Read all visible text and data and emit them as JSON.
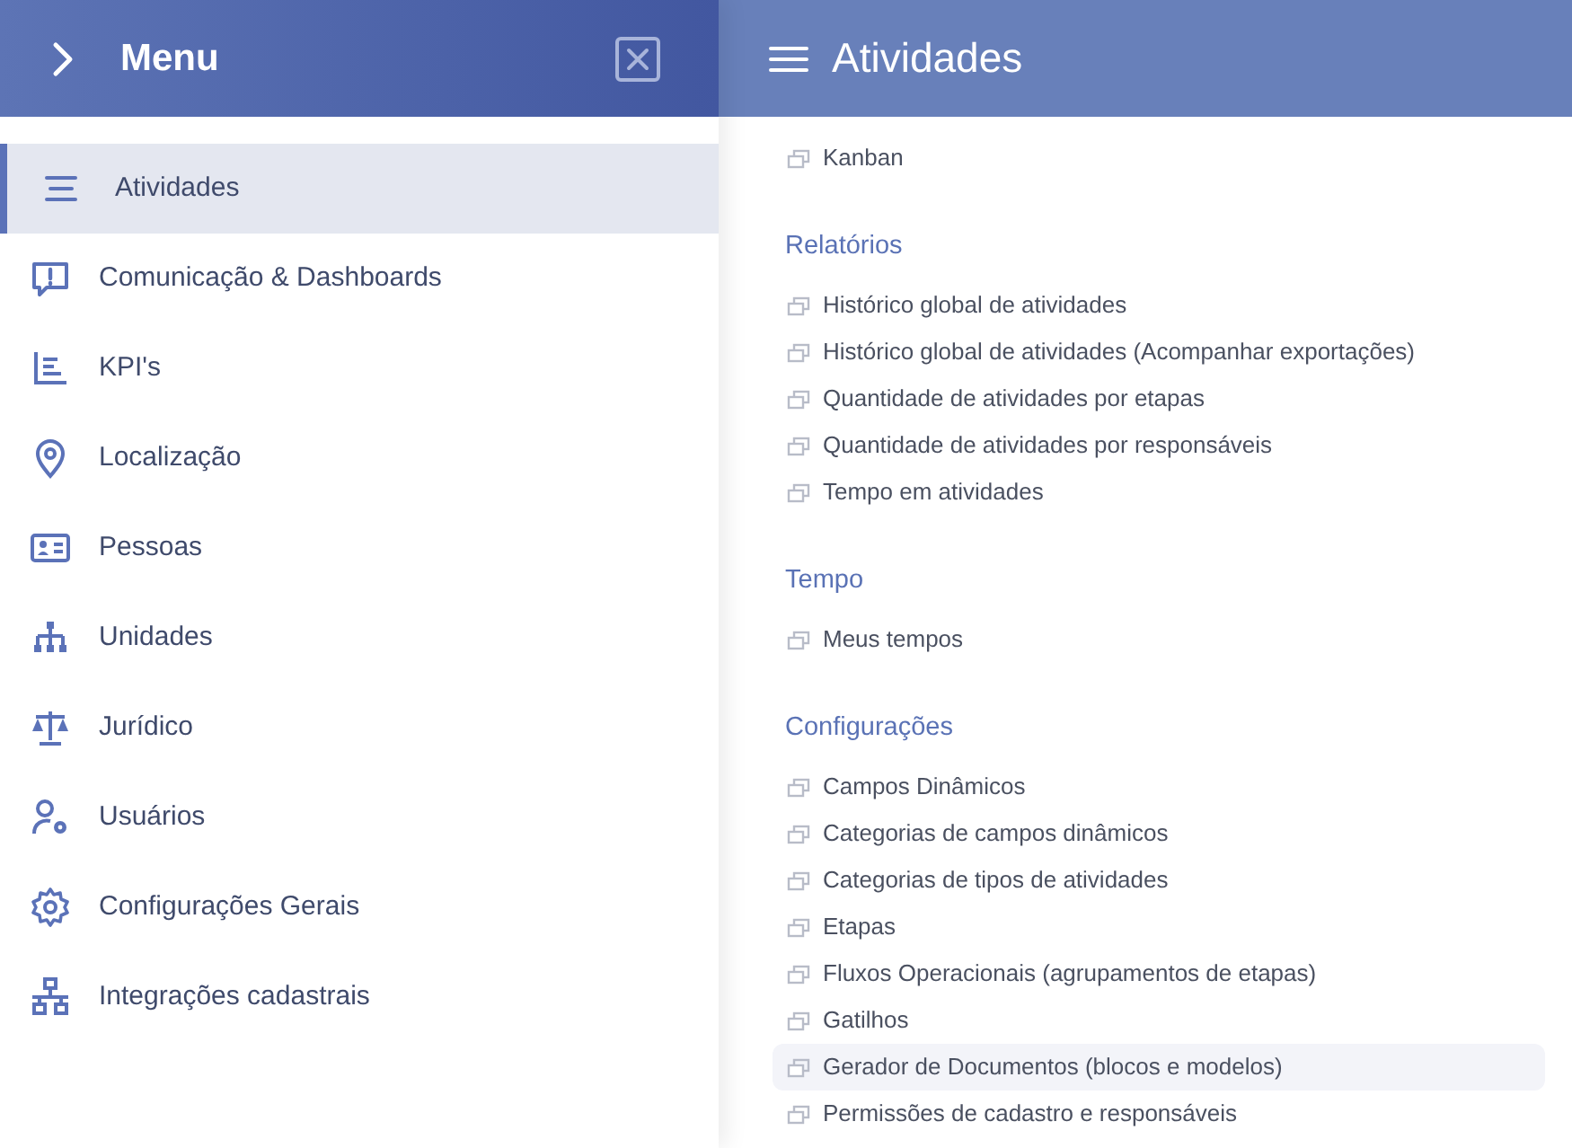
{
  "menu": {
    "title": "Menu",
    "items": [
      {
        "label": "Atividades",
        "selected": true
      },
      {
        "label": "Comunicação & Dashboards",
        "selected": false
      },
      {
        "label": "KPI's",
        "selected": false
      },
      {
        "label": "Localização",
        "selected": false
      },
      {
        "label": "Pessoas",
        "selected": false
      },
      {
        "label": "Unidades",
        "selected": false
      },
      {
        "label": "Jurídico",
        "selected": false
      },
      {
        "label": "Usuários",
        "selected": false
      },
      {
        "label": "Configurações Gerais",
        "selected": false
      },
      {
        "label": "Integrações cadastrais",
        "selected": false
      }
    ]
  },
  "panel": {
    "title": "Atividades",
    "sections": [
      {
        "items": [
          {
            "label": "Kanban",
            "selected": false
          }
        ]
      },
      {
        "heading": "Relatórios",
        "items": [
          {
            "label": "Histórico global de atividades",
            "selected": false
          },
          {
            "label": "Histórico global de atividades (Acompanhar exportações)",
            "selected": false
          },
          {
            "label": "Quantidade de atividades por etapas",
            "selected": false
          },
          {
            "label": "Quantidade de atividades por responsáveis",
            "selected": false
          },
          {
            "label": "Tempo em atividades",
            "selected": false
          }
        ]
      },
      {
        "heading": "Tempo",
        "items": [
          {
            "label": "Meus tempos",
            "selected": false
          }
        ]
      },
      {
        "heading": "Configurações",
        "items": [
          {
            "label": "Campos Dinâmicos",
            "selected": false
          },
          {
            "label": "Categorias de campos dinâmicos",
            "selected": false
          },
          {
            "label": "Categorias de tipos de atividades",
            "selected": false
          },
          {
            "label": "Etapas",
            "selected": false
          },
          {
            "label": "Fluxos Operacionais (agrupamentos de etapas)",
            "selected": false
          },
          {
            "label": "Gatilhos",
            "selected": false
          },
          {
            "label": "Gerador de Documentos (blocos e modelos)",
            "selected": true
          },
          {
            "label": "Permissões de cadastro e responsáveis",
            "selected": false
          }
        ]
      }
    ]
  }
}
